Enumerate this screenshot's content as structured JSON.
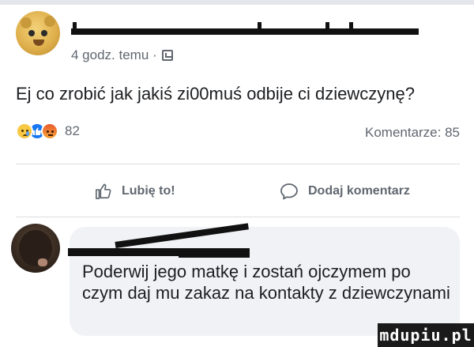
{
  "post": {
    "meta_time": "4 godz. temu ·",
    "meta_icon": "photo-icon",
    "text": "Ej co zrobić jak jakiś zi00muś odbije ci dziewczynę?",
    "reaction_icons": [
      "sad-reaction-icon",
      "like-reaction-icon",
      "angry-reaction-icon"
    ],
    "reaction_count": "82",
    "comments_label": "Komentarze: 85"
  },
  "actions": {
    "like_label": "Lubię to!",
    "like_icon": "thumbs-up-icon",
    "comment_label": "Dodaj komentarz",
    "comment_icon": "speech-bubble-icon"
  },
  "comment": {
    "text": "Poderwij jego matkę i zostań ojczymem po czym daj mu zakaz na kontakty z dziewczynami"
  },
  "watermark": {
    "text": "mdupiu.pl"
  },
  "colors": {
    "meta_gray": "#606770",
    "text": "#1c1e21",
    "like_blue": "#1877f2",
    "bubble_bg": "#f0f2f5",
    "divider": "#dadde1"
  }
}
